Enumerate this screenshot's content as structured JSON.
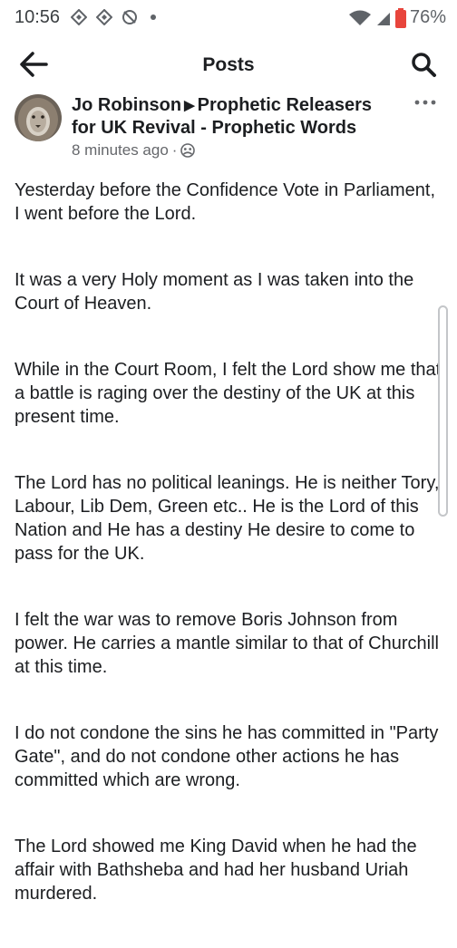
{
  "status_bar": {
    "time": "10:56",
    "battery": "76%",
    "icons": [
      "signal-app-icon",
      "signal-app-icon",
      "no-camera-icon",
      "dot-icon",
      "wifi-icon",
      "cell-signal-icon",
      "battery-icon"
    ]
  },
  "header": {
    "title": "Posts",
    "back_icon": "arrow-left-icon",
    "search_icon": "search-icon"
  },
  "post": {
    "author": "Jo Robinson",
    "group": "Prophetic Releasers for UK Revival - Prophetic Words",
    "time": "8 minutes ago",
    "privacy_icon": "group-audience-icon",
    "more_icon": "more-horizontal-icon",
    "paragraphs": [
      "Yesterday before the Confidence Vote in Parliament, I went before the Lord.",
      "It was a very Holy moment as I was taken into the Court of Heaven.",
      "While in the Court Room, I felt the Lord show me that a battle is raging over the destiny of the UK at this present time.",
      "The Lord has no political leanings. He is neither Tory, Labour, Lib Dem, Green etc.. He is the Lord of this Nation and He has a destiny He desire to come to pass for the UK.",
      "I felt the war was to remove Boris Johnson from power. He carries a mantle similar to that of Churchill at this time.",
      "I do not condone the sins he has committed in \"Party Gate\", and do not condone other actions he has committed which are wrong.",
      "The Lord showed me King David when he had the affair with Bathsheba and had her husband Uriah murdered."
    ]
  },
  "colors": {
    "text": "#1c1e21",
    "secondary": "#65676b",
    "battery_low": "#e8453c"
  }
}
